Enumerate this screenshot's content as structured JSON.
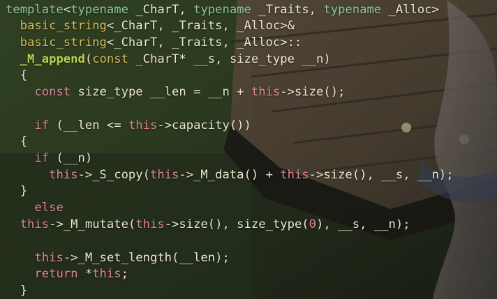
{
  "window": {
    "title": ""
  },
  "colors": {
    "background": "#2c2f24",
    "default_text": "#ece6d2",
    "keyword_green": "#8fc59a",
    "keyword_pink": "#e0849a",
    "type_yellow": "#d6b85c",
    "function_green": "#b9d44a",
    "number": "#e0849a"
  },
  "code": {
    "lines": [
      {
        "tokens": [
          {
            "c": "kw-green",
            "t": "template"
          },
          {
            "c": "t",
            "t": "<"
          },
          {
            "c": "kw-green",
            "t": "typename"
          },
          {
            "c": "t",
            "t": " _CharT, "
          },
          {
            "c": "kw-green",
            "t": "typename"
          },
          {
            "c": "t",
            "t": " _Traits, "
          },
          {
            "c": "kw-green",
            "t": "typename"
          },
          {
            "c": "t",
            "t": " _Alloc>"
          }
        ]
      },
      {
        "tokens": [
          {
            "c": "t",
            "t": "  "
          },
          {
            "c": "type-yellow",
            "t": "basic_string"
          },
          {
            "c": "t",
            "t": "<_CharT, _Traits, _Alloc>&"
          }
        ]
      },
      {
        "tokens": [
          {
            "c": "t",
            "t": "  "
          },
          {
            "c": "type-yellow",
            "t": "basic_string"
          },
          {
            "c": "t",
            "t": "<_CharT, _Traits, _Alloc>::"
          }
        ]
      },
      {
        "tokens": [
          {
            "c": "t",
            "t": "  "
          },
          {
            "c": "fn-green",
            "t": "_M_append"
          },
          {
            "c": "t",
            "t": "("
          },
          {
            "c": "type-yellow",
            "t": "const"
          },
          {
            "c": "t",
            "t": " _CharT* __s, size_type __n)"
          }
        ]
      },
      {
        "tokens": [
          {
            "c": "t",
            "t": "  {"
          }
        ]
      },
      {
        "tokens": [
          {
            "c": "t",
            "t": "    "
          },
          {
            "c": "kw-pink",
            "t": "const"
          },
          {
            "c": "t",
            "t": " size_type __len = __n + "
          },
          {
            "c": "kw-pink",
            "t": "this"
          },
          {
            "c": "t",
            "t": "->size();"
          }
        ]
      },
      {
        "tokens": [
          {
            "c": "t",
            "t": ""
          }
        ]
      },
      {
        "tokens": [
          {
            "c": "t",
            "t": "    "
          },
          {
            "c": "kw-pink",
            "t": "if"
          },
          {
            "c": "t",
            "t": " (__len <= "
          },
          {
            "c": "kw-pink",
            "t": "this"
          },
          {
            "c": "t",
            "t": "->capacity())"
          }
        ]
      },
      {
        "tokens": [
          {
            "c": "t",
            "t": "  {"
          }
        ]
      },
      {
        "tokens": [
          {
            "c": "t",
            "t": "    "
          },
          {
            "c": "kw-pink",
            "t": "if"
          },
          {
            "c": "t",
            "t": " (__n)"
          }
        ]
      },
      {
        "tokens": [
          {
            "c": "t",
            "t": "      "
          },
          {
            "c": "kw-pink",
            "t": "this"
          },
          {
            "c": "t",
            "t": "->_S_copy("
          },
          {
            "c": "kw-pink",
            "t": "this"
          },
          {
            "c": "t",
            "t": "->_M_data() + "
          },
          {
            "c": "kw-pink",
            "t": "this"
          },
          {
            "c": "t",
            "t": "->size(), __s, __n);"
          }
        ]
      },
      {
        "tokens": [
          {
            "c": "t",
            "t": "  }"
          }
        ]
      },
      {
        "tokens": [
          {
            "c": "t",
            "t": "    "
          },
          {
            "c": "kw-pink",
            "t": "else"
          }
        ]
      },
      {
        "tokens": [
          {
            "c": "t",
            "t": "  "
          },
          {
            "c": "kw-pink",
            "t": "this"
          },
          {
            "c": "t",
            "t": "->_M_mutate("
          },
          {
            "c": "kw-pink",
            "t": "this"
          },
          {
            "c": "t",
            "t": "->size(), size_type("
          },
          {
            "c": "num",
            "t": "0"
          },
          {
            "c": "t",
            "t": "), __s, __n);"
          }
        ]
      },
      {
        "tokens": [
          {
            "c": "t",
            "t": ""
          }
        ]
      },
      {
        "tokens": [
          {
            "c": "t",
            "t": "    "
          },
          {
            "c": "kw-pink",
            "t": "this"
          },
          {
            "c": "t",
            "t": "->_M_set_length(__len);"
          }
        ]
      },
      {
        "tokens": [
          {
            "c": "t",
            "t": "    "
          },
          {
            "c": "kw-pink",
            "t": "return"
          },
          {
            "c": "t",
            "t": " *"
          },
          {
            "c": "kw-pink",
            "t": "this"
          },
          {
            "c": "t",
            "t": ";"
          }
        ]
      },
      {
        "tokens": [
          {
            "c": "t",
            "t": "  }"
          }
        ]
      }
    ]
  }
}
